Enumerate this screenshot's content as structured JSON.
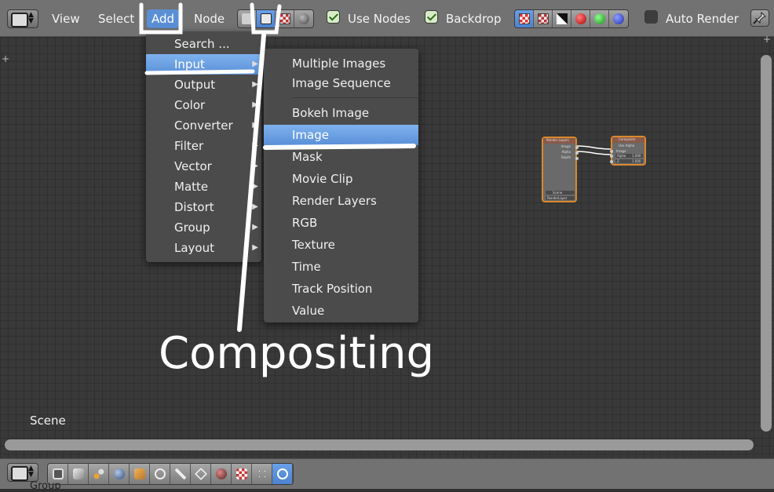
{
  "header": {
    "menus": [
      {
        "label": "View"
      },
      {
        "label": "Select"
      },
      {
        "label": "Add"
      },
      {
        "label": "Node"
      }
    ],
    "use_nodes_label": "Use Nodes",
    "use_nodes_checked": true,
    "backdrop_label": "Backdrop",
    "backdrop_checked": true,
    "auto_render_label": "Auto Render",
    "auto_render_checked": false
  },
  "add_menu": {
    "items": [
      {
        "label": "Search ...",
        "submenu": false
      },
      {
        "label": "Input",
        "submenu": true,
        "highlighted": true
      },
      {
        "label": "Output",
        "submenu": true
      },
      {
        "label": "Color",
        "submenu": true
      },
      {
        "label": "Converter",
        "submenu": true
      },
      {
        "label": "Filter",
        "submenu": true
      },
      {
        "label": "Vector",
        "submenu": true
      },
      {
        "label": "Matte",
        "submenu": true
      },
      {
        "label": "Distort",
        "submenu": true
      },
      {
        "label": "Group",
        "submenu": true
      },
      {
        "label": "Layout",
        "submenu": true
      }
    ]
  },
  "input_submenu": {
    "items": [
      {
        "label": "Multiple Images"
      },
      {
        "label": "Image Sequence"
      },
      {
        "label": "Bokeh Image"
      },
      {
        "label": "Image",
        "highlighted": true
      },
      {
        "label": "Mask"
      },
      {
        "label": "Movie Clip"
      },
      {
        "label": "Render Layers"
      },
      {
        "label": "RGB"
      },
      {
        "label": "Texture"
      },
      {
        "label": "Time"
      },
      {
        "label": "Track Position"
      },
      {
        "label": "Value"
      }
    ]
  },
  "nodes": {
    "render_layers": {
      "title": "Render Layers",
      "outputs": [
        "Image",
        "Alpha",
        "Depth"
      ],
      "scene_field": "Scene",
      "layer_field": "RenderLayer"
    },
    "composite": {
      "title": "Composite",
      "use_alpha": "Use Alpha",
      "inputs": [
        "Image",
        "Alpha",
        "Z"
      ],
      "alpha_value": "1.000",
      "z_value": "1.000"
    }
  },
  "canvas": {
    "scene_label": "Scene",
    "footer_group_label": "Group"
  },
  "annotation": {
    "text": "Compositing"
  },
  "colors": {
    "menu_highlight": "#5a8fd8",
    "node_selected_border": "#d9892d",
    "annotation_stroke": "#ffffff"
  },
  "icons": {
    "header_render": [
      "image-icon",
      "checker-icon",
      "sphere-icon"
    ],
    "header_backdrop": [
      "checker-red-icon",
      "checker-icon",
      "alpha-icon",
      "red-channel-icon",
      "green-channel-icon",
      "blue-channel-icon"
    ],
    "footer": [
      "camera-icon",
      "render-icon",
      "renderlayers-icon",
      "world-icon",
      "object-icon",
      "constraint-icon",
      "modifier-icon",
      "mesh-icon",
      "material-icon",
      "texture-icon",
      "particles-icon",
      "node-editor-icon"
    ]
  }
}
